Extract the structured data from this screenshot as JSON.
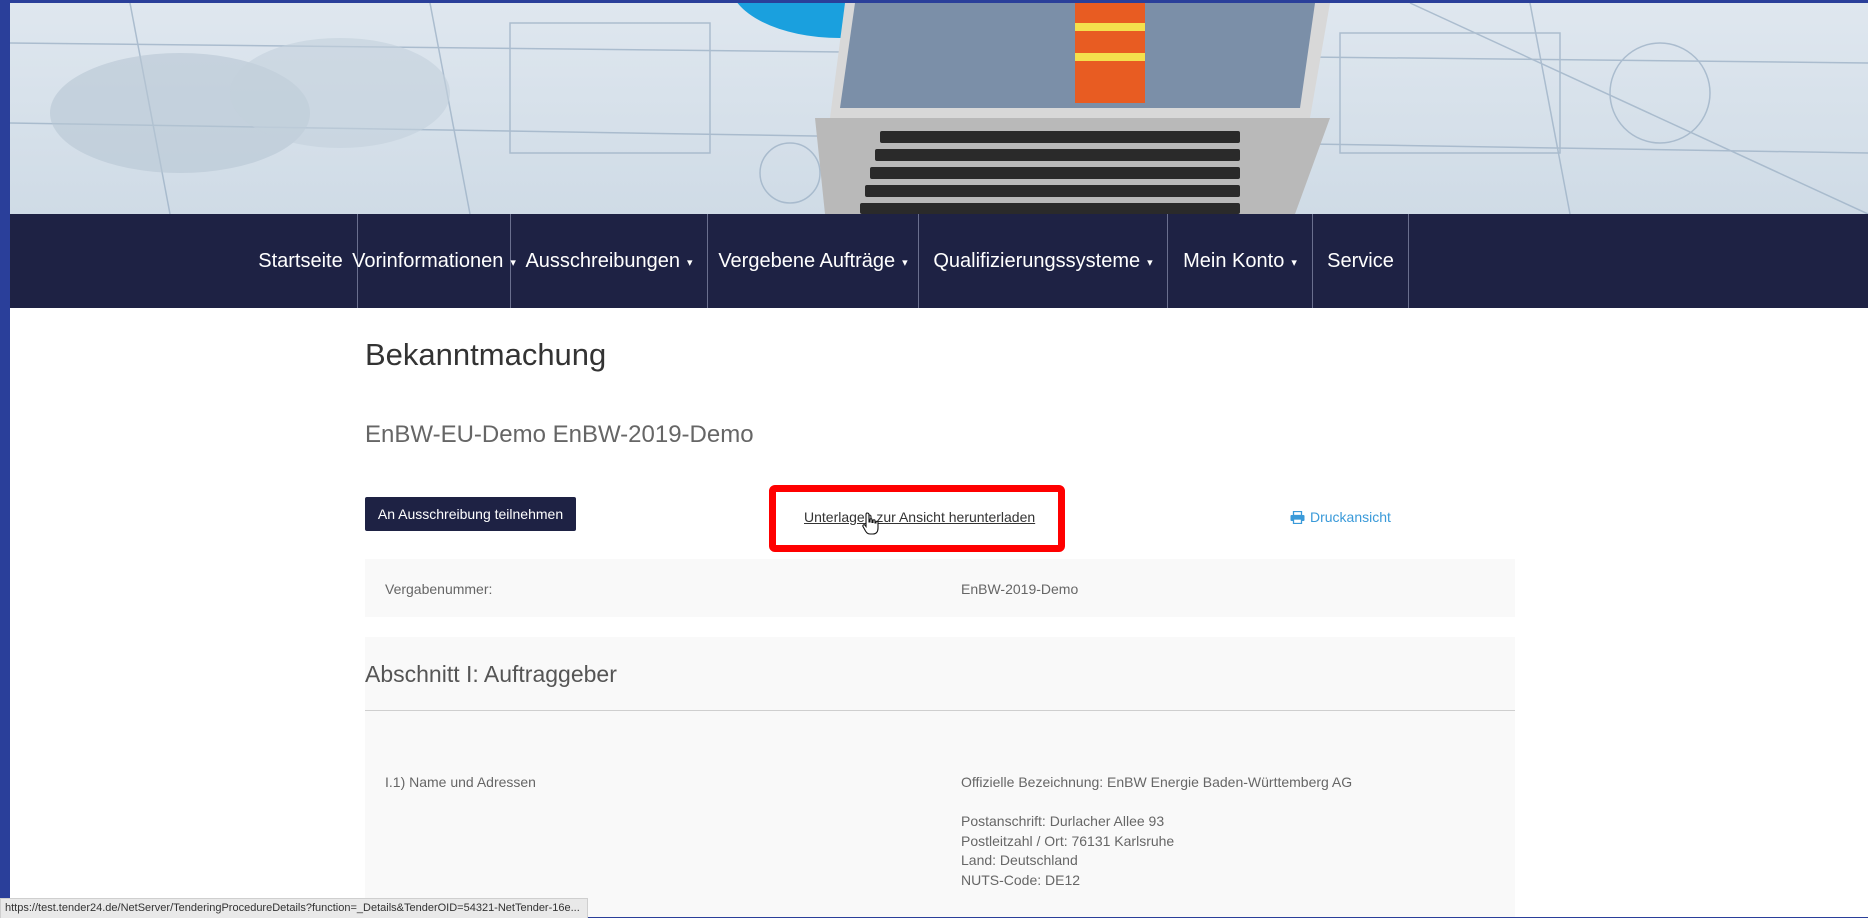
{
  "nav": {
    "items": [
      {
        "label": "Startseite",
        "caret": false
      },
      {
        "label": "Vorinformationen",
        "caret": true
      },
      {
        "label": "Ausschreibungen",
        "caret": true
      },
      {
        "label": "Vergebene Aufträge",
        "caret": true
      },
      {
        "label": "Qualifizierungssysteme",
        "caret": true
      },
      {
        "label": "Mein Konto",
        "caret": true
      },
      {
        "label": "Service",
        "caret": false
      }
    ],
    "caret_symbol": "▾"
  },
  "page": {
    "title": "Bekanntmachung",
    "subtitle": "EnBW-EU-Demo EnBW-2019-Demo"
  },
  "actions": {
    "participate_label": "An Ausschreibung teilnehmen",
    "download_label": "Unterlagen zur Ansicht herunterladen",
    "print_label": "Druckansicht"
  },
  "vergabe": {
    "label": "Vergabenummer:",
    "value": "EnBW-2019-Demo"
  },
  "section1": {
    "title": "Abschnitt I: Auftraggeber",
    "row_label": "I.1) Name und Adressen",
    "official_name": "Offizielle Bezeichnung: EnBW Energie Baden-Württemberg AG",
    "address_lines": [
      "Postanschrift: Durlacher Allee 93",
      "Postleitzahl / Ort: 76131 Karlsruhe",
      "Land: Deutschland",
      "NUTS-Code: DE12"
    ]
  },
  "status_bar": {
    "url": "https://test.tender24.de/NetServer/TenderingProcedureDetails?function=_Details&TenderOID=54321-NetTender-16e..."
  },
  "colors": {
    "nav_bg": "#1e2244",
    "highlight": "#ff0000",
    "link_blue": "#3a9ad9"
  }
}
